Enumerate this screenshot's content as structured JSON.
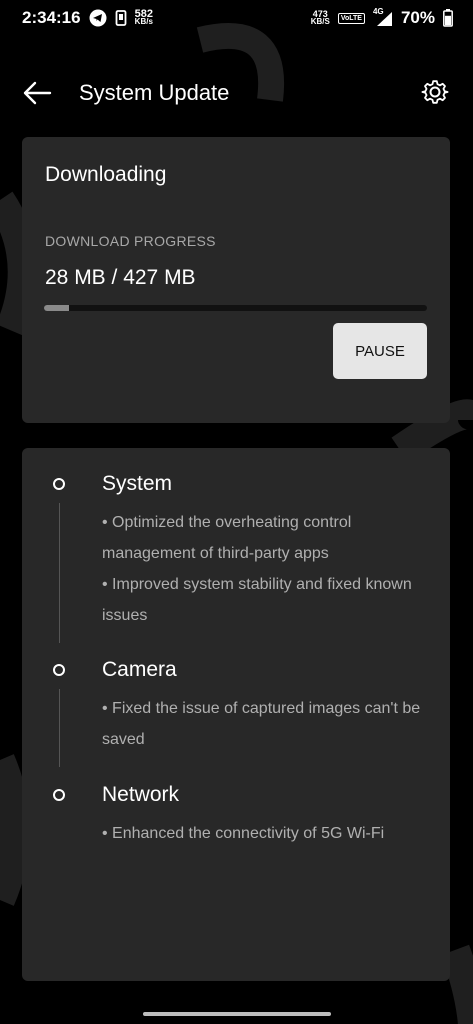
{
  "status_bar": {
    "time": "2:34:16",
    "data_speed_value": "582",
    "data_speed_unit": "KB/s",
    "net_speed_value": "473",
    "net_speed_unit": "KB/S",
    "volte": "VoLTE",
    "network": "4G",
    "battery": "70%",
    "battery_level": 0.7
  },
  "header": {
    "title": "System Update",
    "back_icon": "arrow-left-icon",
    "settings_icon": "gear-icon"
  },
  "download": {
    "status": "Downloading",
    "progress_label": "DOWNLOAD PROGRESS",
    "amount": "28 MB / 427 MB",
    "progress_fraction": 0.0656,
    "pause_label": "PAUSE"
  },
  "changelog": [
    {
      "title": "System",
      "lines": [
        "• Optimized the overheating control management of third-party apps",
        "• Improved system stability and fixed known issues"
      ]
    },
    {
      "title": "Camera",
      "lines": [
        "• Fixed the issue of captured images can't be saved"
      ]
    },
    {
      "title": "Network",
      "lines": [
        "• Enhanced the connectivity of 5G Wi-Fi"
      ]
    }
  ],
  "colors": {
    "background": "#000000",
    "card": "#282828",
    "secondary_text": "#b0b0b0",
    "button": "#e6e6e6"
  }
}
